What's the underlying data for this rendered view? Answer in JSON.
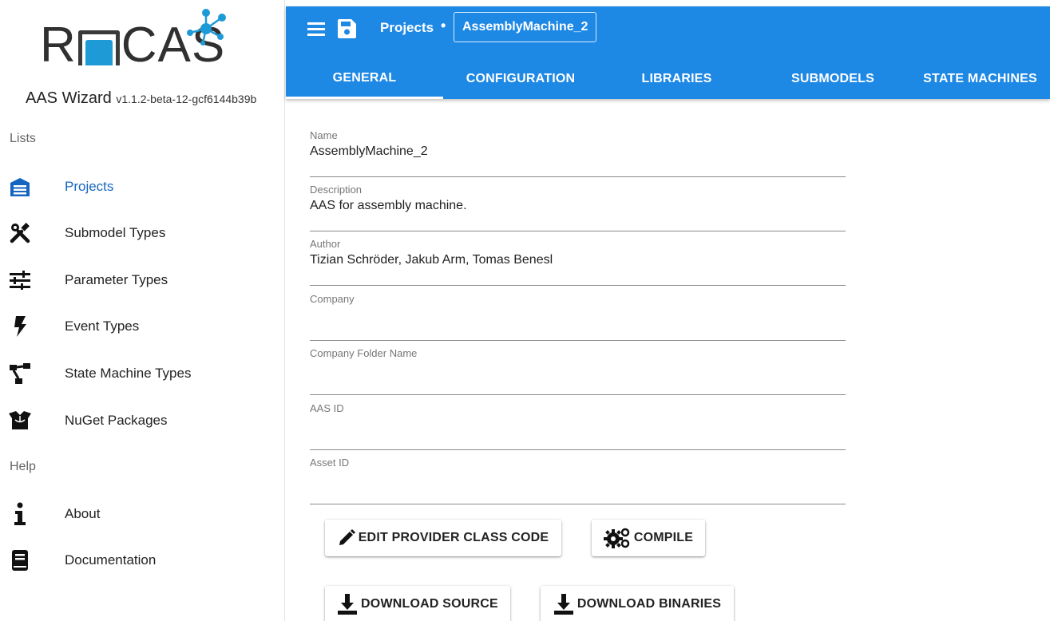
{
  "sidebar": {
    "logo": {
      "text_left": "R",
      "text_right": "CAS",
      "accent_color": "#1e9bd7"
    },
    "app_title": "AAS Wizard",
    "app_version": "v1.1.2-beta-12-gcf6144b39b",
    "lists_label": "Lists",
    "help_label": "Help",
    "items": [
      {
        "label": "Projects",
        "icon": "warehouse-icon",
        "active": true
      },
      {
        "label": "Submodel Types",
        "icon": "tools-icon"
      },
      {
        "label": "Parameter Types",
        "icon": "tune-icon"
      },
      {
        "label": "Event Types",
        "icon": "flash-icon"
      },
      {
        "label": "State Machine Types",
        "icon": "state-machine-icon"
      },
      {
        "label": "NuGet Packages",
        "icon": "package-icon"
      }
    ],
    "help_items": [
      {
        "label": "About",
        "icon": "info-icon"
      },
      {
        "label": "Documentation",
        "icon": "book-icon"
      }
    ]
  },
  "header": {
    "menu_icon": "menu-icon",
    "save_icon": "save-icon",
    "breadcrumb_projects": "Projects",
    "breadcrumb_separator": "•",
    "breadcrumb_current": "AssemblyMachine_2",
    "accent_color": "#1e88e5",
    "tabs": [
      {
        "label": "GENERAL",
        "active": true
      },
      {
        "label": "CONFIGURATION"
      },
      {
        "label": "LIBRARIES"
      },
      {
        "label": "SUBMODELS"
      },
      {
        "label": "STATE MACHINES"
      }
    ]
  },
  "form": {
    "fields": [
      {
        "label": "Name",
        "value": "AssemblyMachine_2"
      },
      {
        "label": "Description",
        "value": "AAS for assembly machine."
      },
      {
        "label": "Author",
        "value": "Tizian Schröder, Jakub Arm, Tomas Benesl"
      },
      {
        "label": "Company",
        "value": ""
      },
      {
        "label": "Company Folder Name",
        "value": ""
      },
      {
        "label": "AAS ID",
        "value": ""
      },
      {
        "label": "Asset ID",
        "value": ""
      }
    ],
    "buttons": {
      "edit_provider": {
        "label": "EDIT PROVIDER CLASS CODE",
        "icon": "pencil-icon"
      },
      "compile": {
        "label": "COMPILE",
        "icon": "gears-icon"
      },
      "download_source": {
        "label": "DOWNLOAD SOURCE",
        "icon": "download-icon"
      },
      "download_binaries": {
        "label": "DOWNLOAD BINARIES",
        "icon": "download-icon"
      }
    }
  }
}
